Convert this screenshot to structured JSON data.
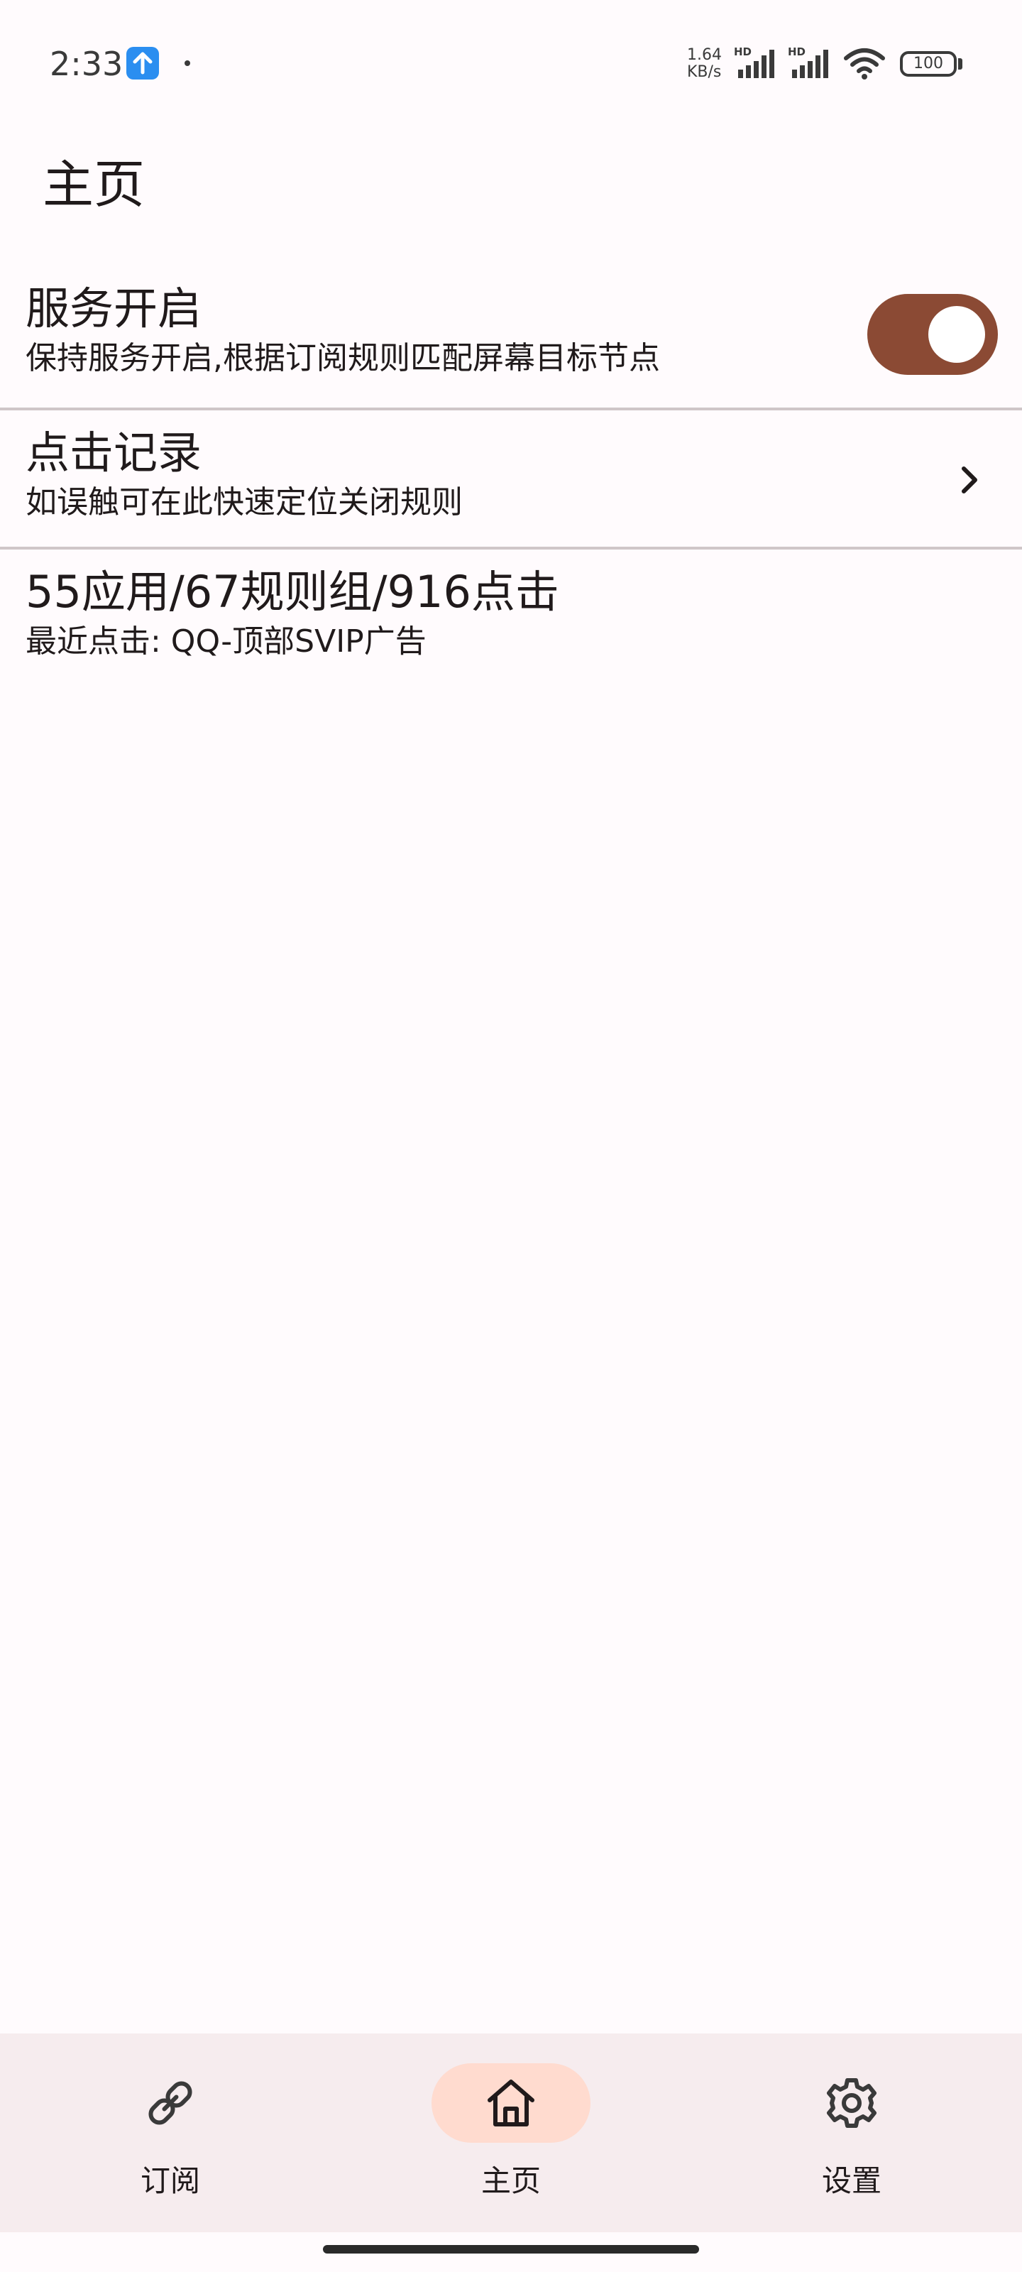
{
  "status_bar": {
    "time": "2:33",
    "net_speed_value": "1.64",
    "net_speed_unit": "KB/s",
    "hd_label": "HD",
    "battery": "100",
    "icons": [
      "upload-icon",
      "signal-icon",
      "wifi-icon",
      "battery-icon"
    ]
  },
  "header": {
    "title": "主页"
  },
  "rows": [
    {
      "title": "服务开启",
      "subtitle": "保持服务开启,根据订阅规则匹配屏幕目标节点"
    },
    {
      "title": "点击记录",
      "subtitle": "如误触可在此快速定位关闭规则"
    },
    {
      "title": "55应用/67规则组/916点击",
      "subtitle": "最近点击: QQ-顶部SVIP广告"
    }
  ],
  "service_toggle": {
    "on": true,
    "color": "#8b4a34"
  },
  "bottom_nav": {
    "items": [
      {
        "label": "订阅",
        "icon": "link-icon",
        "active": false
      },
      {
        "label": "主页",
        "icon": "home-icon",
        "active": true
      },
      {
        "label": "设置",
        "icon": "gear-icon",
        "active": false
      }
    ],
    "active_indicator_color": "#ffdbcf"
  }
}
